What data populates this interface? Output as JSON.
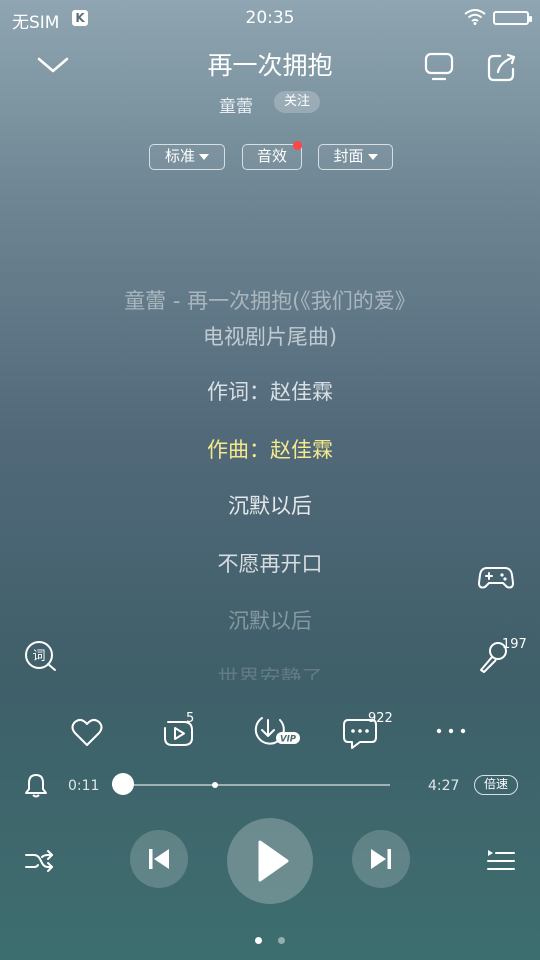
{
  "status_bar": {
    "carrier": "无SIM",
    "k_badge": "K",
    "time": "20:35"
  },
  "header": {
    "song_title": "再一次拥抱",
    "artist": "童蕾",
    "follow_label": "关注"
  },
  "toolbar": {
    "quality_label": "标准",
    "effects_label": "音效",
    "cover_label": "封面"
  },
  "lyrics": {
    "lines": [
      "童蕾 - 再一次拥抱(《我们的爱》",
      "电视剧片尾曲)",
      "作词：赵佳霖",
      "作曲：赵佳霖",
      "沉默以后",
      "不愿再开口",
      "沉默以后",
      "世界安静了"
    ],
    "active_index": 3,
    "active_color": "#f4ea8c"
  },
  "side": {
    "mic_count": "197"
  },
  "actions": {
    "repeat_count": "5",
    "comment_count": "922",
    "download_badge": "VIP"
  },
  "progress": {
    "current": "0:11",
    "total": "4:27",
    "speed_label": "倍速",
    "fraction": 0.041,
    "buffered_fraction": 0.37
  },
  "pager": {
    "pages": 2,
    "active": 0
  }
}
